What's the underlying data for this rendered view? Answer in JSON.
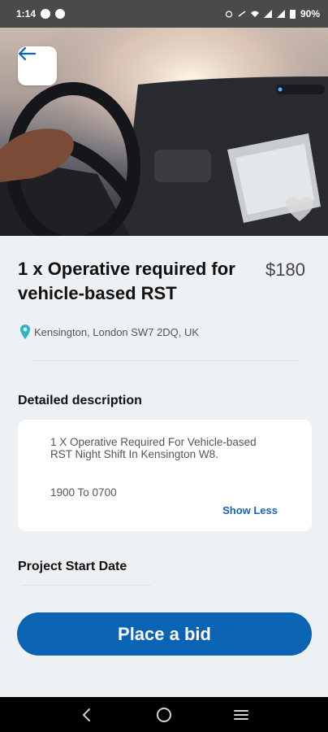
{
  "status_bar": {
    "time": "1:14",
    "battery": "90%"
  },
  "listing": {
    "title": "1 x Operative required for vehicle-based RST",
    "price": "$180",
    "location": "Kensington, London SW7 2DQ, UK"
  },
  "description": {
    "heading": "Detailed description",
    "body": "1 X Operative Required For Vehicle-based RST Night Shift In Kensington W8.",
    "hours": "1900 To 0700",
    "toggle_label": "Show Less"
  },
  "project": {
    "start_date_heading": "Project Start Date"
  },
  "actions": {
    "bid_label": "Place a bid"
  },
  "colors": {
    "accent": "#0b63b4",
    "background": "#eef1f4",
    "pin": "#2bb5c7"
  },
  "icons": {
    "back": "arrow-left-icon",
    "favorite": "heart-icon",
    "location": "map-pin-icon",
    "nav_back": "chevron-left-icon",
    "nav_home": "circle-home-icon",
    "nav_recents": "menu-lines-icon"
  }
}
